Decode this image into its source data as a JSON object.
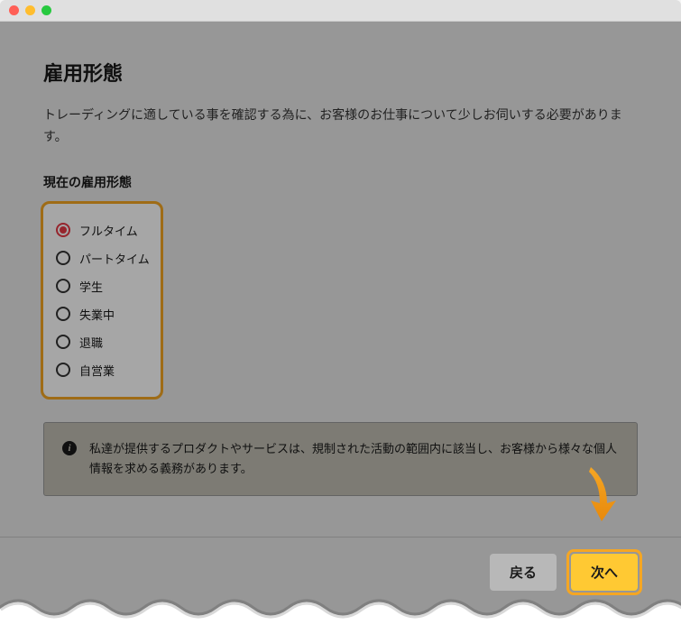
{
  "page": {
    "title": "雇用形態",
    "description": "トレーディングに適している事を確認する為に、お客様のお仕事について少しお伺いする必要があります。",
    "section_label": "現在の雇用形態"
  },
  "employment_options": [
    {
      "label": "フルタイム",
      "selected": true
    },
    {
      "label": "パートタイム",
      "selected": false
    },
    {
      "label": "学生",
      "selected": false
    },
    {
      "label": "失業中",
      "selected": false
    },
    {
      "label": "退職",
      "selected": false
    },
    {
      "label": "自営業",
      "selected": false
    }
  ],
  "info_box": {
    "text": "私達が提供するプロダクトやサービスは、規制された活動の範囲内に該当し、お客様から様々な個人情報を求める義務があります。"
  },
  "buttons": {
    "back": "戻る",
    "next": "次へ"
  },
  "colors": {
    "highlight": "#f5a623",
    "primary_button": "#ffc933",
    "radio_selected": "#e63946"
  }
}
